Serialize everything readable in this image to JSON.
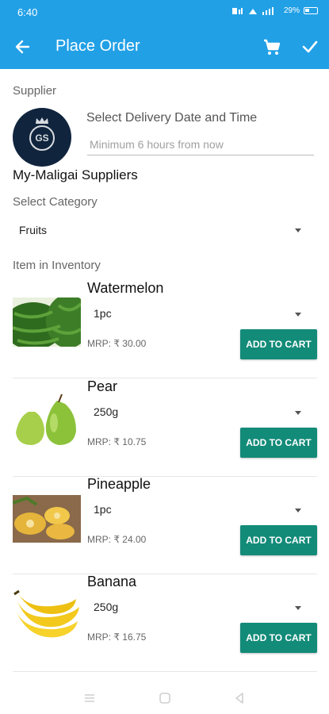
{
  "status_bar": {
    "time": "6:40",
    "icons": [
      "lte-signal-icon",
      "wifi-call-icon",
      "signal-icon",
      "battery-icon"
    ],
    "battery_text": "29%"
  },
  "app_bar": {
    "title": "Place Order",
    "background": "#21a0e6",
    "actions": [
      "cart-icon",
      "check-icon"
    ]
  },
  "supplier": {
    "label": "Supplier",
    "logo_text": "GS",
    "name": "My-Maligai Suppliers"
  },
  "delivery": {
    "label": "Select Delivery Date and Time",
    "placeholder": "Minimum 6 hours from now",
    "value": ""
  },
  "category": {
    "label": "Select Category",
    "selected": "Fruits"
  },
  "inventory": {
    "label": "Item in Inventory",
    "add_label": "ADD TO CART",
    "button_color": "#138b79",
    "items": [
      {
        "name": "Watermelon",
        "qty": "1pc",
        "mrp": "MRP: ₹ 30.00"
      },
      {
        "name": "Pear",
        "qty": "250g",
        "mrp": "MRP: ₹ 10.75"
      },
      {
        "name": "Pineapple",
        "qty": "1pc",
        "mrp": "MRP: ₹ 24.00"
      },
      {
        "name": "Banana",
        "qty": "250g",
        "mrp": "MRP: ₹ 16.75"
      }
    ]
  },
  "nav": {
    "icons": [
      "menu-icon",
      "home-icon",
      "back-nav-icon"
    ]
  }
}
